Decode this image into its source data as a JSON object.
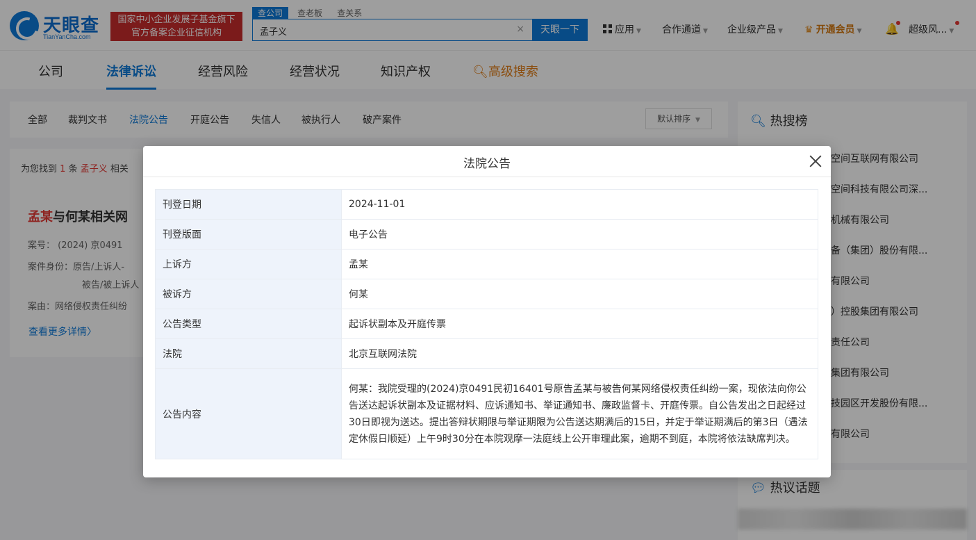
{
  "header": {
    "logo_text": "天眼查",
    "logo_sub": "TianYanCha.com",
    "org_badge_line1": "国家中小企业发展子基金旗下",
    "org_badge_line2": "官方备案企业征信机构",
    "search_tabs": [
      "查公司",
      "查老板",
      "查关系"
    ],
    "search_value": "孟子义",
    "search_clear": "×",
    "search_button": "天眼一下",
    "apps": "应用",
    "cooperation": "合作通道",
    "enterprise": "企业级产品",
    "vip": "开通会员",
    "user": "超级风..."
  },
  "main_nav": {
    "company": "公司",
    "legal": "法律诉讼",
    "risk": "经营风险",
    "status": "经营状况",
    "ip": "知识产权",
    "advanced": "高级搜索"
  },
  "filters": {
    "all": "全部",
    "judgments": "裁判文书",
    "court_notices": "法院公告",
    "hearing_notices": "开庭公告",
    "dishonest": "失信人",
    "executed": "被执行人",
    "bankruptcy": "破产案件",
    "sort": "默认排序"
  },
  "results": {
    "prefix": "为您找到",
    "count": "1",
    "unit": "条",
    "keyword": "孟子义",
    "suffix": "相关",
    "case_title_highlight": "孟某",
    "case_title_rest": "与何某相关网",
    "case_no": "案号： (2024) 京0491",
    "case_identity": "案件身份：原告/上诉人-",
    "case_identity2": "被告/被上诉人",
    "case_reason": "案由：网络侵权责任纠纷",
    "more": "查看更多详情"
  },
  "sidebar": {
    "hot_title": "热搜榜",
    "hot_items": [
      "元空间互联网有限公司",
      "元空间科技有限公司深...",
      "工机械有限公司",
      "装备（集团）股份有限...",
      "业有限公司",
      "巴）控股集团有限公司",
      "限责任公司",
      "股集团有限公司",
      "科技园区开发股份有限...",
      "团有限公司"
    ],
    "topic_title": "热议话题"
  },
  "modal": {
    "title": "法院公告",
    "rows": [
      {
        "key": "刊登日期",
        "value": "2024-11-01"
      },
      {
        "key": "刊登版面",
        "value": "电子公告"
      },
      {
        "key": "上诉方",
        "value": "孟某"
      },
      {
        "key": "被诉方",
        "value": "何某"
      },
      {
        "key": "公告类型",
        "value": "起诉状副本及开庭传票"
      },
      {
        "key": "法院",
        "value": "北京互联网法院"
      },
      {
        "key": "公告内容",
        "value": "何某：我院受理的(2024)京0491民初16401号原告孟某与被告何某网络侵权责任纠纷一案，现依法向你公告送达起诉状副本及证据材料、应诉通知书、举证通知书、廉政监督卡、开庭传票。自公告发出之日起经过30日即视为送达。提出答辩状期限与举证期限为公告送达期满后的15日，并定于举证期满后的第3日（遇法定休假日顺延）上午9时30分在本院观摩一法庭线上公开审理此案，逾期不到庭，本院将依法缺席判决。"
      }
    ]
  }
}
